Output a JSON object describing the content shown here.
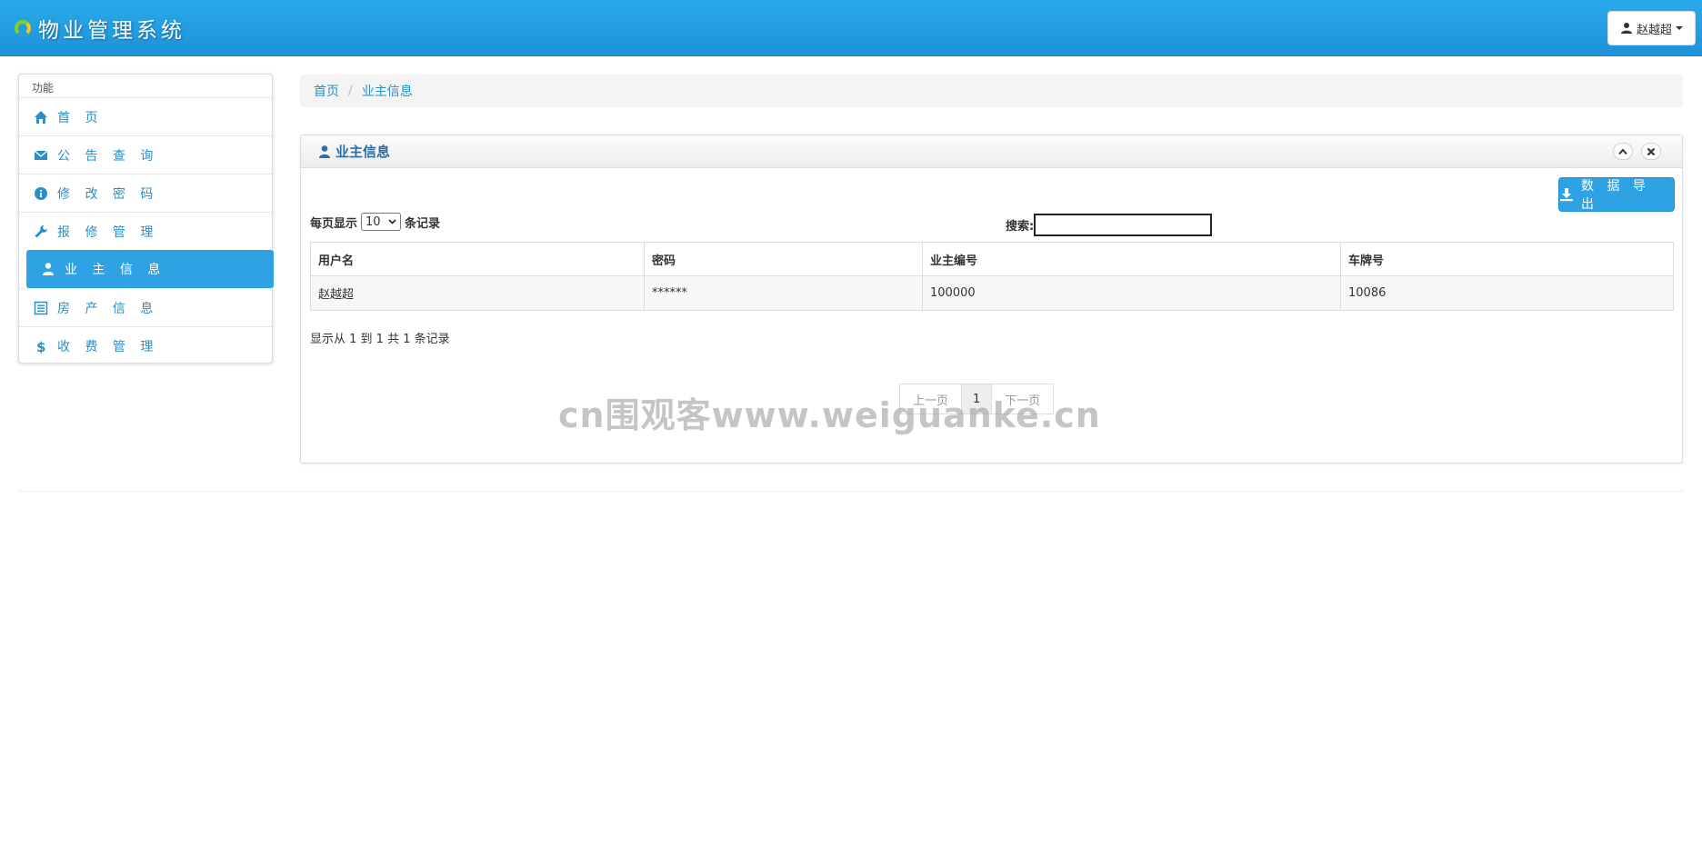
{
  "app": {
    "title": "物业管理系统"
  },
  "user_menu": {
    "name": "赵越超"
  },
  "sidebar": {
    "header": "功能",
    "items": [
      {
        "label": "首 页",
        "icon": "home-icon"
      },
      {
        "label": "公 告 查 询",
        "icon": "envelope-icon"
      },
      {
        "label": "修 改 密 码",
        "icon": "info-icon"
      },
      {
        "label": "报 修 管 理",
        "icon": "wrench-icon"
      },
      {
        "label": "业 主 信 息",
        "icon": "user-icon",
        "active": true
      },
      {
        "label": "房 产 信 息",
        "icon": "list-alt-icon"
      },
      {
        "label": "收 费 管 理",
        "icon": "dollar-icon"
      }
    ]
  },
  "breadcrumb": {
    "home": "首页",
    "current": "业主信息"
  },
  "panel": {
    "title": "业主信息",
    "export_label": "数 据 导 出",
    "length_prefix": "每页显示",
    "length_value": "10",
    "length_suffix": "条记录",
    "search_label": "搜索:",
    "search_value": "",
    "columns": [
      "用户名",
      "密码",
      "业主编号",
      "车牌号"
    ],
    "rows": [
      [
        "赵越超",
        "******",
        "100000",
        "10086"
      ]
    ],
    "info": "显示从 1 到 1 共 1 条记录",
    "pager": {
      "prev": "上一页",
      "current": "1",
      "next": "下一页"
    }
  },
  "watermark": "cn围观客www.weiguanke.cn",
  "colors": {
    "accent": "#2ea2e2",
    "navbar": "#2aa9ea",
    "link": "#2a8fc9"
  }
}
